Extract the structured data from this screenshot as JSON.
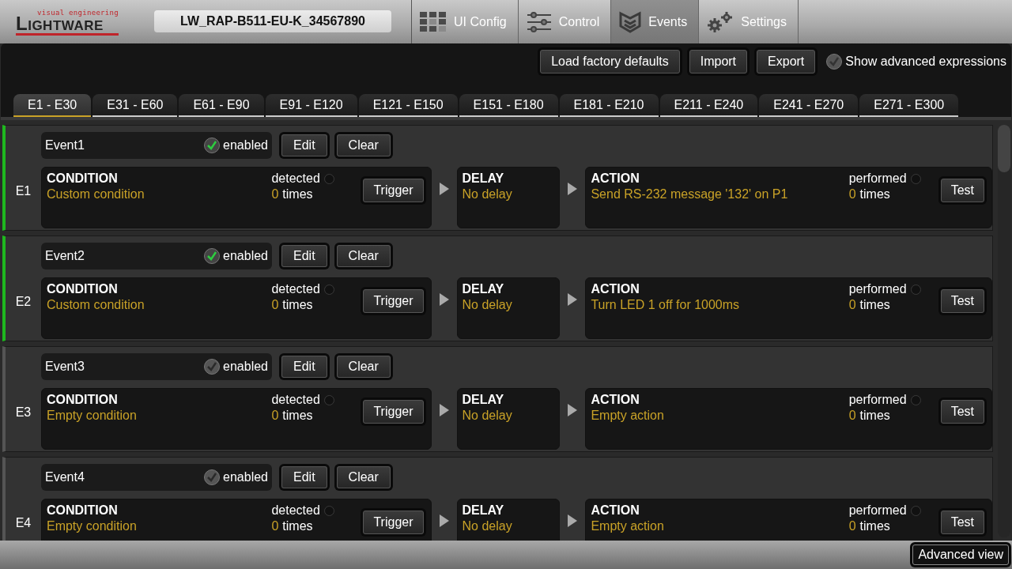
{
  "logo": {
    "tagline": "visual engineering",
    "name": "LIGHTWARE"
  },
  "device_name": "LW_RAP-B511-EU-K_34567890",
  "nav_tabs": [
    {
      "label": "UI Config",
      "kind": "grid",
      "selected": false
    },
    {
      "label": "Control",
      "kind": "sliders",
      "selected": false
    },
    {
      "label": "Events",
      "kind": "events",
      "selected": true
    },
    {
      "label": "Settings",
      "kind": "gears",
      "selected": false
    }
  ],
  "toolbar": {
    "buttons": [
      "Load factory defaults",
      "Import",
      "Export"
    ],
    "advanced_expressions": {
      "label": "Show advanced expressions",
      "checked": false
    }
  },
  "range_tabs": [
    {
      "label": "E1 - E30",
      "selected": true
    },
    {
      "label": "E31 - E60",
      "selected": false
    },
    {
      "label": "E61 - E90",
      "selected": false
    },
    {
      "label": "E91 - E120",
      "selected": false
    },
    {
      "label": "E121 - E150",
      "selected": false
    },
    {
      "label": "E151 - E180",
      "selected": false
    },
    {
      "label": "E181 - E210",
      "selected": false
    },
    {
      "label": "E211 - E240",
      "selected": false
    },
    {
      "label": "E241 - E270",
      "selected": false
    },
    {
      "label": "E271 - E300",
      "selected": false
    }
  ],
  "events": [
    {
      "id": "E1",
      "name": "Event1",
      "enabled_label": "enabled",
      "enabled": true,
      "edit": "Edit",
      "clear": "Clear",
      "condition": {
        "title": "CONDITION",
        "text": "Custom condition",
        "status": "detected",
        "count": "0",
        "unit": "times",
        "button": "Trigger"
      },
      "delay": {
        "title": "DELAY",
        "text": "No delay"
      },
      "action": {
        "title": "ACTION",
        "text": "Send RS-232 message '132' on P1",
        "status": "performed",
        "count": "0",
        "unit": "times",
        "button": "Test"
      }
    },
    {
      "id": "E2",
      "name": "Event2",
      "enabled_label": "enabled",
      "enabled": true,
      "edit": "Edit",
      "clear": "Clear",
      "condition": {
        "title": "CONDITION",
        "text": "Custom condition",
        "status": "detected",
        "count": "0",
        "unit": "times",
        "button": "Trigger"
      },
      "delay": {
        "title": "DELAY",
        "text": "No delay"
      },
      "action": {
        "title": "ACTION",
        "text": "Turn LED 1 off for 1000ms",
        "status": "performed",
        "count": "0",
        "unit": "times",
        "button": "Test"
      }
    },
    {
      "id": "E3",
      "name": "Event3",
      "enabled_label": "enabled",
      "enabled": false,
      "edit": "Edit",
      "clear": "Clear",
      "condition": {
        "title": "CONDITION",
        "text": "Empty condition",
        "status": "detected",
        "count": "0",
        "unit": "times",
        "button": "Trigger"
      },
      "delay": {
        "title": "DELAY",
        "text": "No delay"
      },
      "action": {
        "title": "ACTION",
        "text": "Empty action",
        "status": "performed",
        "count": "0",
        "unit": "times",
        "button": "Test"
      }
    },
    {
      "id": "E4",
      "name": "Event4",
      "enabled_label": "enabled",
      "enabled": false,
      "edit": "Edit",
      "clear": "Clear",
      "condition": {
        "title": "CONDITION",
        "text": "Empty condition",
        "status": "detected",
        "count": "0",
        "unit": "times",
        "button": "Trigger"
      },
      "delay": {
        "title": "DELAY",
        "text": "No delay"
      },
      "action": {
        "title": "ACTION",
        "text": "Empty action",
        "status": "performed",
        "count": "0",
        "unit": "times",
        "button": "Test"
      }
    }
  ],
  "footer": {
    "button": "Advanced view"
  }
}
